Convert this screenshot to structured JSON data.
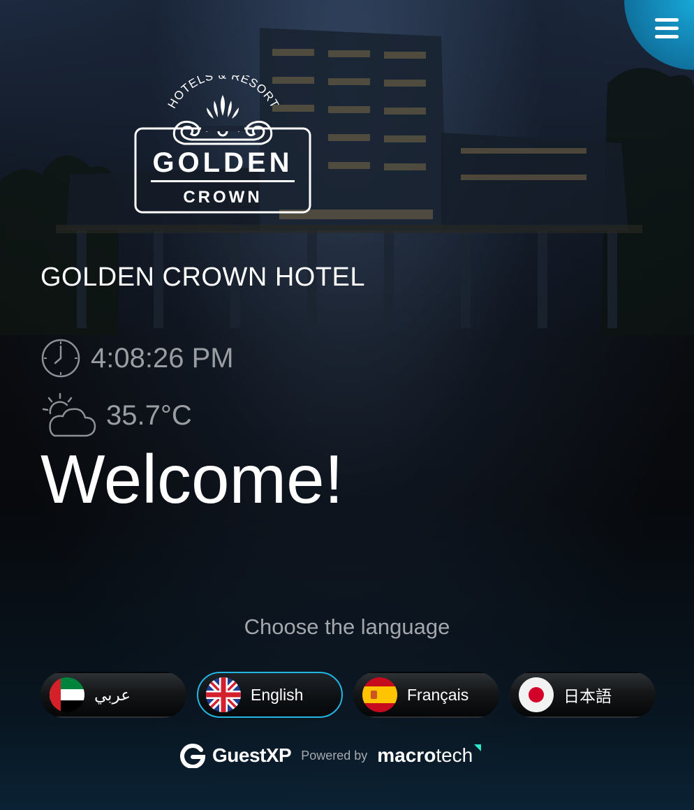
{
  "hotel": {
    "name": "GOLDEN CROWN HOTEL"
  },
  "logo": {
    "top_text": "HOTELS & RESORT",
    "main": "GOLDEN",
    "sub": "CROWN"
  },
  "status": {
    "time": "4:08:26 PM",
    "temperature": "35.7°C",
    "time_icon": "clock-icon",
    "weather_icon": "partly-cloudy-icon"
  },
  "welcome": "Welcome!",
  "language_prompt": "Choose the language",
  "languages": [
    {
      "label": "عربي",
      "flag": "uae-flag-icon",
      "selected": false
    },
    {
      "label": "English",
      "flag": "uk-flag-icon",
      "selected": true
    },
    {
      "label": "Français",
      "flag": "spain-flag-icon",
      "selected": false
    },
    {
      "label": "日本語",
      "flag": "japan-flag-icon",
      "selected": false
    }
  ],
  "footer": {
    "brand": "GuestXP",
    "powered_by": "Powered by",
    "partner_bold": "macro",
    "partner_rest": "tech"
  },
  "colors": {
    "accent": "#23b5e3",
    "menu": "#127fae",
    "muted_text": "#9a9ea3"
  },
  "menu_icon": "hamburger-menu-icon"
}
